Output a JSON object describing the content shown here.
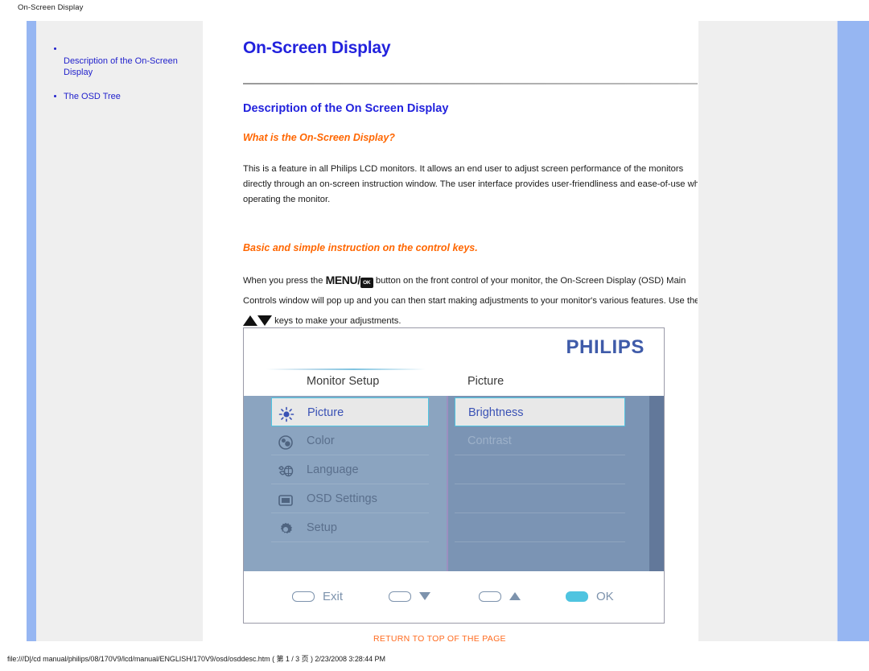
{
  "print": {
    "header_title": "On-Screen Display",
    "footer_path": "file:///D|/cd manual/philips/08/170V9/lcd/manual/ENGLISH/170V9/osd/osddesc.htm ( 第 1 / 3 页 ) 2/23/2008 3:28:44 PM"
  },
  "nav": {
    "items": [
      {
        "label": "Description of the On-Screen Display"
      },
      {
        "label": "The OSD Tree"
      }
    ]
  },
  "content": {
    "page_title": "On-Screen Display",
    "section_title": "Description of the On Screen Display",
    "sub_title_1": "What is the On-Screen Display?",
    "paragraph_1": "This is a feature in all Philips LCD monitors. It allows an end user to adjust screen performance of the monitors directly through an on-screen instruction window. The user interface provides user-friendliness and ease-of-use when operating the monitor.",
    "sub_title_2": "Basic and simple instruction on the control keys.",
    "paragraph_2_a": "When you press the",
    "menu_glyph": "MENU",
    "menu_slash": "/",
    "ok_glyph": "OK",
    "paragraph_2_b": "button on the front control of your monitor, the On-Screen Display (OSD) Main Controls window will pop up and you can then start making adjustments to your monitor's various features. Use the",
    "paragraph_2_c": "keys to make your adjustments.",
    "return_link": "RETURN TO TOP OF THE PAGE"
  },
  "osd": {
    "brand": "PHILIPS",
    "header_left": "Monitor Setup",
    "header_right": "Picture",
    "left_menu": [
      {
        "label": "Picture",
        "icon": "brightness-icon",
        "selected": true
      },
      {
        "label": "Color",
        "icon": "color-wheel-icon",
        "selected": false
      },
      {
        "label": "Language",
        "icon": "language-icon",
        "selected": false
      },
      {
        "label": "OSD Settings",
        "icon": "osd-monitor-icon",
        "selected": false
      },
      {
        "label": "Setup",
        "icon": "gear-icon",
        "selected": false
      }
    ],
    "right_menu": [
      {
        "label": "Brightness",
        "selected": true
      },
      {
        "label": "Contrast",
        "selected": false
      },
      {
        "label": "",
        "selected": false
      },
      {
        "label": "",
        "selected": false
      },
      {
        "label": "",
        "selected": false
      }
    ],
    "footer_buttons": [
      {
        "label": "Exit",
        "glyph": "none",
        "active": false
      },
      {
        "label": "",
        "glyph": "down",
        "active": false
      },
      {
        "label": "",
        "glyph": "up",
        "active": false
      },
      {
        "label": "OK",
        "glyph": "none",
        "active": true
      }
    ]
  },
  "colors": {
    "link_blue": "#2222cc",
    "heading_blue": "#2222dd",
    "accent_orange": "#ff6600",
    "rail_blue": "#96b6f2",
    "panel_grey": "#efefef",
    "osd_highlight": "#4fc4e0"
  }
}
